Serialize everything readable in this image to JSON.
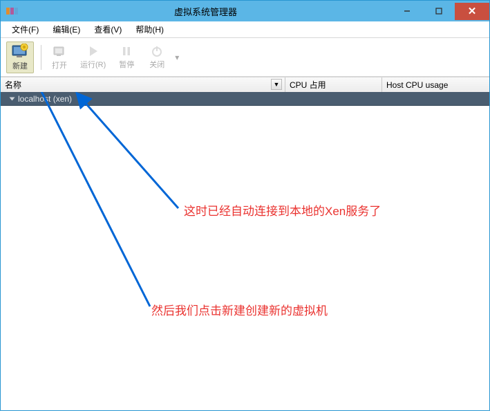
{
  "titlebar": {
    "title": "虚拟系统管理器"
  },
  "menu": {
    "file": "文件(F)",
    "edit": "编辑(E)",
    "view": "查看(V)",
    "help": "帮助(H)"
  },
  "toolbar": {
    "new": "新建",
    "open": "打开",
    "run": "运行(R)",
    "pause": "暂停",
    "shutdown": "关闭"
  },
  "columns": {
    "name": "名称",
    "cpu": "CPU 占用",
    "host": "Host CPU usage"
  },
  "hosts": [
    {
      "label": "localhost (xen)"
    }
  ],
  "annotations": {
    "a1": "这时已经自动连接到本地的Xen服务了",
    "a2": "然后我们点击新建创建新的虚拟机"
  }
}
